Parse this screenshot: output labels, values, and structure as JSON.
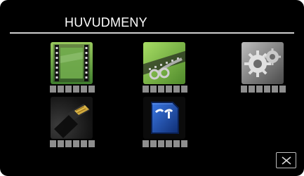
{
  "header": {
    "title": "HUVUDMENY"
  },
  "menu": {
    "items": [
      {
        "name": "movie-icon"
      },
      {
        "name": "edit-icon"
      },
      {
        "name": "setup-gear-icon"
      },
      {
        "name": "hdmi-icon"
      },
      {
        "name": "sd-card-icon"
      }
    ]
  },
  "close_button": {
    "icon": "close-icon"
  },
  "colors": {
    "screen": "#000000",
    "title_text": "#ffffff",
    "underline": "#cfcfcf",
    "placeholder": "#8e8e8e",
    "movie_green": "#6fa13a",
    "edit_green": "#8cc63f",
    "setup_gray": "#8a8a8a",
    "hdmi_dark": "#2a2a2a",
    "sd_blue": "#2a63c9"
  }
}
